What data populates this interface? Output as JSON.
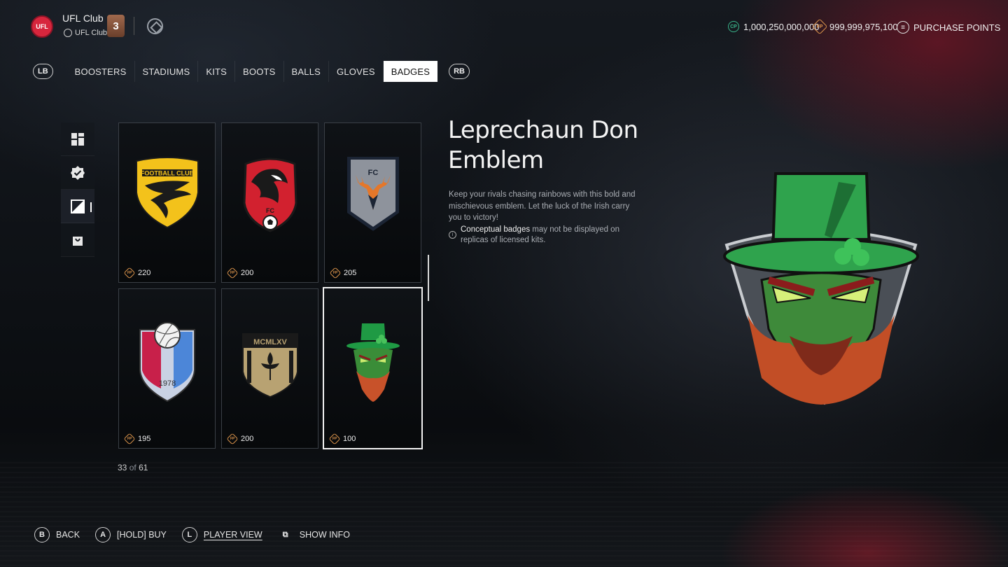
{
  "header": {
    "club_name": "UFL Club",
    "club_sub": "UFL Club",
    "club_logo_text": "UFL",
    "level": "3",
    "cp_label": "CP",
    "cp_balance": "1,000,250,000,000",
    "fp_label": "FP",
    "fp_balance": "999,999,975,100",
    "purchase_label": "PURCHASE POINTS"
  },
  "tabs": {
    "lb": "LB",
    "rb": "RB",
    "items": [
      "BOOSTERS",
      "STADIUMS",
      "KITS",
      "BOOTS",
      "BALLS",
      "GLOVES",
      "BADGES"
    ],
    "active": "BADGES"
  },
  "filters": [
    "grid-icon",
    "verified-icon",
    "contrast-icon",
    "shop-bag-icon"
  ],
  "grid": {
    "currency_label": "FP",
    "cards": [
      {
        "name": "football-club-eagle-badge",
        "price": "220",
        "badge_text": "FOOTBALL CLUB"
      },
      {
        "name": "red-eagle-fc-badge",
        "price": "200",
        "badge_text": "FC"
      },
      {
        "name": "stag-fc-badge",
        "price": "205",
        "badge_text": "FC"
      },
      {
        "name": "volleyball-1978-badge",
        "price": "195",
        "badge_text": "1978"
      },
      {
        "name": "mcmlxv-fleur-badge",
        "price": "200",
        "badge_text": "MCMLXV"
      },
      {
        "name": "leprechaun-don-badge",
        "price": "100",
        "badge_text": ""
      }
    ],
    "count_current": "33",
    "count_of": "of",
    "count_total": "61"
  },
  "detail": {
    "title": "Leprechaun Don Emblem",
    "description": "Keep your rivals chasing rainbows with this bold and mischievous emblem. Let the luck of the Irish carry you to victory!",
    "note_strong": "Conceptual badges",
    "note_rest": " may not be displayed on replicas of licensed kits."
  },
  "footer": [
    {
      "key": "B",
      "label": "BACK",
      "underline": false
    },
    {
      "key": "A",
      "label": "[HOLD] BUY",
      "underline": false
    },
    {
      "key": "L",
      "label": "PLAYER VIEW",
      "underline": true
    },
    {
      "key": "⧉",
      "label": "SHOW INFO",
      "underline": false
    }
  ],
  "colors": {
    "accent_cp": "#39b58b",
    "accent_fp": "#d9924a",
    "club_red": "#d7263d"
  }
}
